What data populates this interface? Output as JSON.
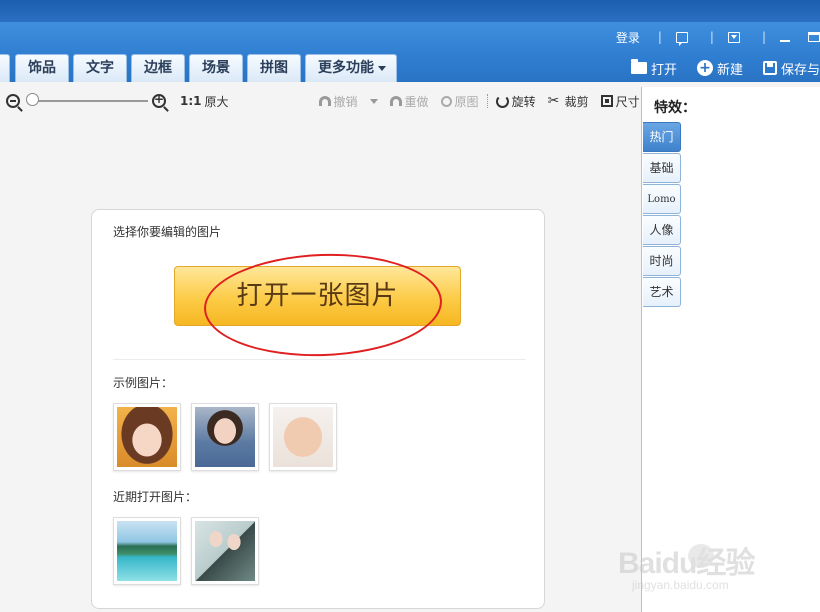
{
  "top_links": {
    "login": "登录",
    "separator": "|"
  },
  "tabs": [
    "饰品",
    "文字",
    "边框",
    "场景",
    "拼图",
    "更多功能"
  ],
  "actions": {
    "open": "打开",
    "new": "新建",
    "save": "保存与"
  },
  "toolbar": {
    "ratio": "1:1",
    "ratio_label": "原大",
    "undo": "撤销",
    "redo": "重做",
    "original": "原图",
    "rotate": "旋转",
    "crop": "裁剪",
    "size": "尺寸"
  },
  "panel": {
    "title": "特效：",
    "tabs": [
      "热门",
      "基础",
      "Lomo",
      "人像",
      "时尚",
      "艺术"
    ],
    "active_index": 0
  },
  "card": {
    "heading": "选择你要编辑的图片",
    "open_button": "打开一张图片",
    "sample_label": "示例图片：",
    "recent_label": "近期打开图片："
  },
  "watermark": {
    "brand": "Baidu经验",
    "url": "jingyan.baidu.com"
  },
  "colors": {
    "titlebar": "#1c5fb0",
    "topbar": "#2f7dd0",
    "open_button": "#fccb46",
    "annotation": "#e02020",
    "active_tab": "#3e82cc"
  }
}
